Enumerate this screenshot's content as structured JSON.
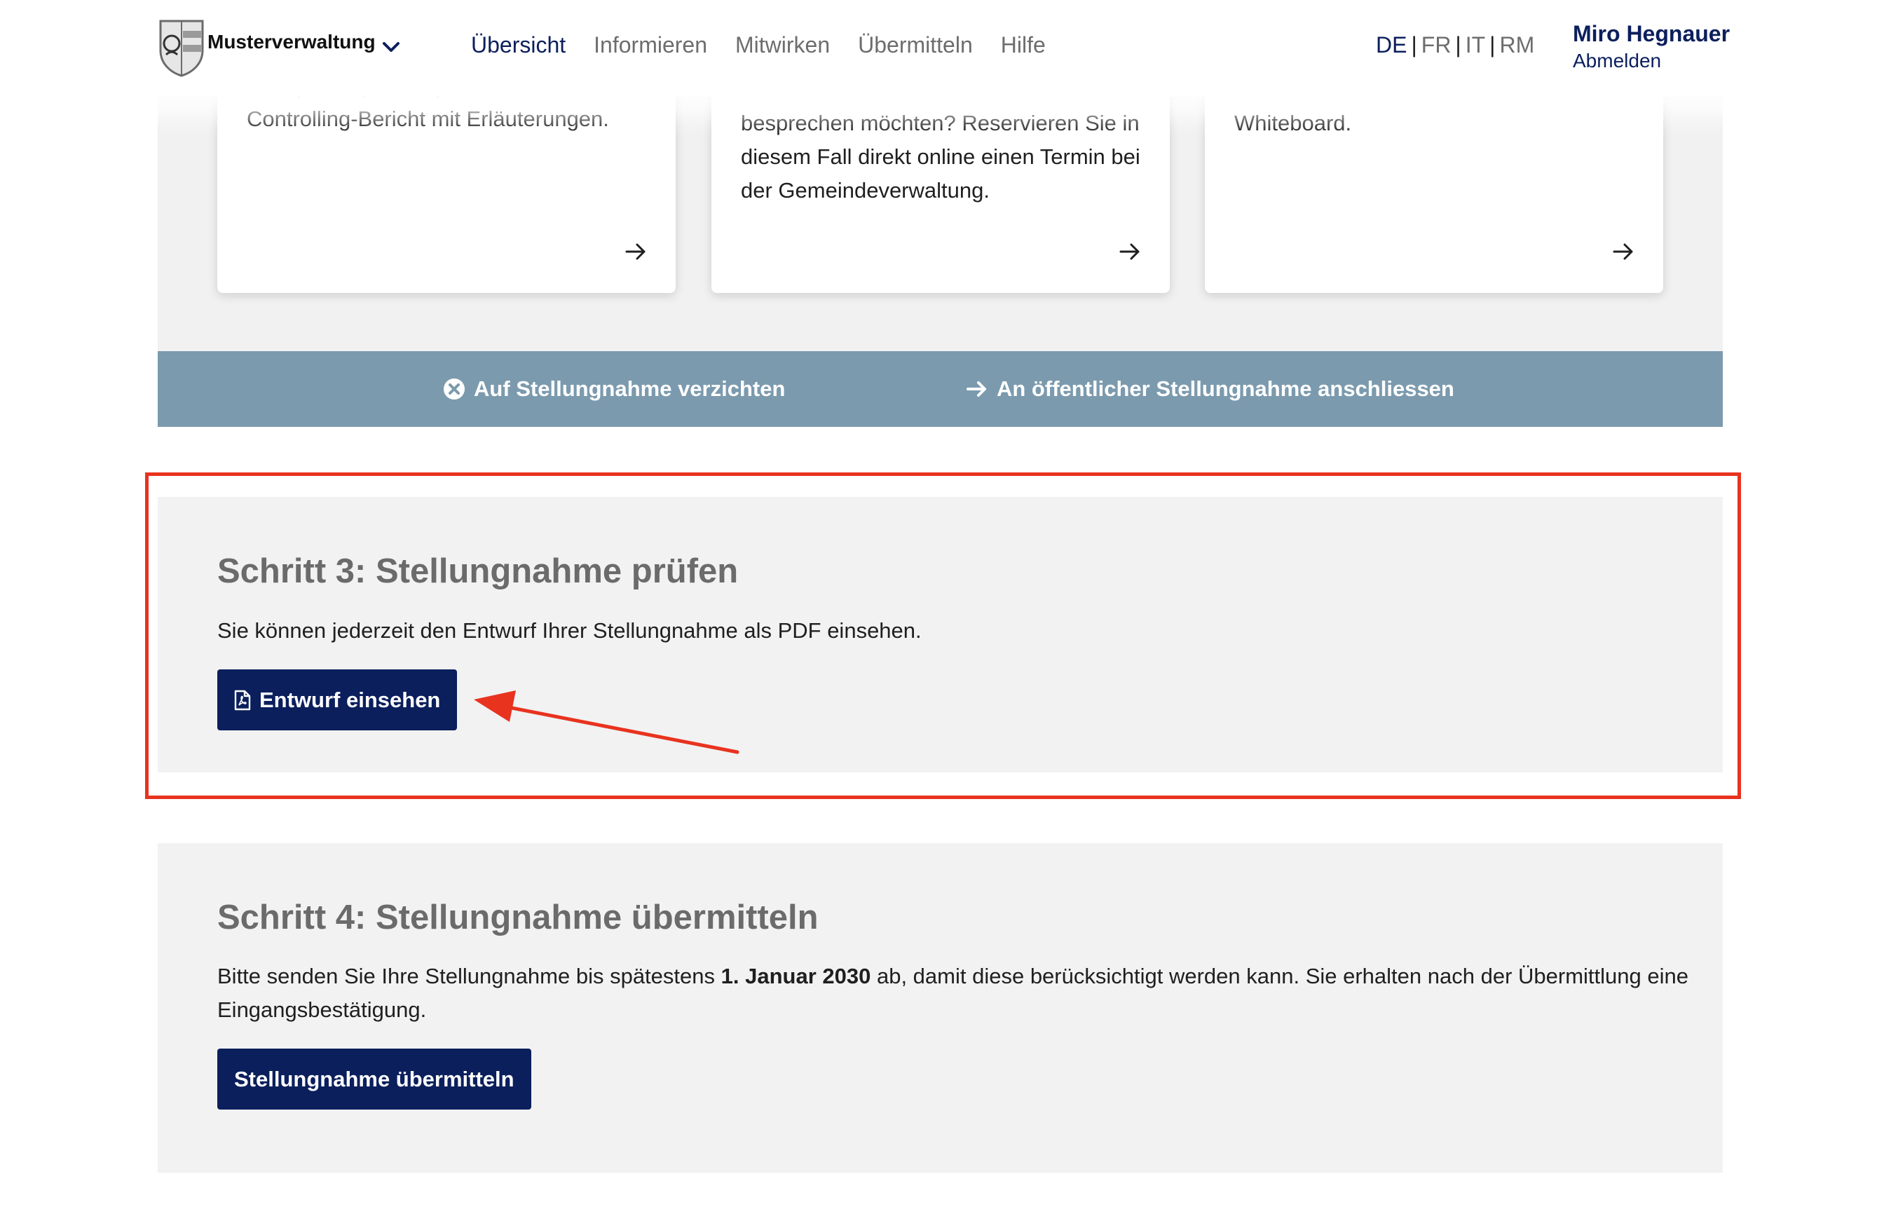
{
  "header": {
    "brand": "Musterverwaltung",
    "nav": [
      "Übersicht",
      "Informieren",
      "Mitwirken",
      "Übermitteln",
      "Hilfe"
    ],
    "nav_active": "Übersicht",
    "languages": [
      "DE",
      "FR",
      "IT",
      "RM"
    ],
    "language_active": "DE",
    "user_name": "Miro Hegnauer",
    "logout": "Abmelden"
  },
  "cards": [
    {
      "text": "Erfassen Sie Ihre Rückmeldung zu den Richtplananpassungen oder zum Controlling-Bericht mit Erläuterungen.",
      "icon": "arrow-right-icon"
    },
    {
      "text": "besprechen möchten? Reservieren Sie in diesem Fall direkt online einen Termin bei der Gemeindeverwaltung.",
      "icon": "arrow-right-icon"
    },
    {
      "text": "Whiteboard.",
      "icon": "arrow-right-icon"
    }
  ],
  "action_bar": {
    "waive": "Auf Stellungnahme verzichten",
    "join": "An öffentlicher Stellungnahme anschliessen"
  },
  "step3": {
    "title": "Schritt 3: Stellungnahme prüfen",
    "text": "Sie können jederzeit den Entwurf Ihrer Stellungnahme als PDF einsehen.",
    "button": "Entwurf einsehen"
  },
  "step4": {
    "title": "Schritt 4: Stellungnahme übermitteln",
    "text_before": "Bitte senden Sie Ihre Stellungnahme bis spätestens",
    "deadline": "1. Januar 2030",
    "text_after": "ab, damit diese berücksichtigt werden kann. Sie erhalten nach der Übermittlung eine Eingangsbestätigung.",
    "button": "Stellungnahme übermitteln"
  },
  "colors": {
    "primary": "#0b1f5c",
    "action_bar": "#7b9aae",
    "section_bg": "#f2f2f2",
    "annotation": "#e8331f"
  }
}
